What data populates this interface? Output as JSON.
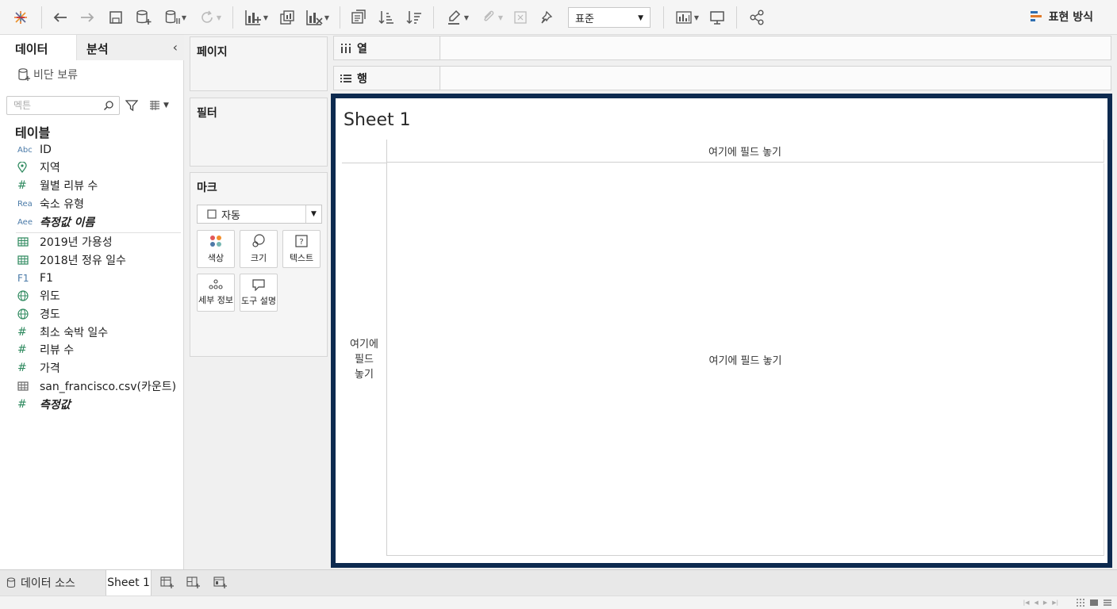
{
  "toolbar": {
    "fit_value": "표준",
    "show_me_label": "표현 방식"
  },
  "data_pane": {
    "tab_data": "데이터",
    "tab_analysis": "분석",
    "pause_updates": "비단 보류",
    "search_placeholder": "멕튼",
    "tables_title": "테이블",
    "fields": [
      {
        "type": "Abc",
        "name": "ID",
        "icon": "string-type-icon"
      },
      {
        "type": "geo",
        "name": "지역",
        "icon": "location-pin-icon"
      },
      {
        "type": "#",
        "name": "월별 리뷰 수",
        "icon": "number-type-icon"
      },
      {
        "type": "Rea",
        "name": "숙소 유형",
        "icon": "string-type-icon"
      },
      {
        "type": "Aee",
        "name": "측정값 이름",
        "icon": "string-type-icon"
      },
      {
        "type": "table",
        "name": "2019년 가용성",
        "icon": "table-icon"
      },
      {
        "type": "table",
        "name": "2018년 정유 일수",
        "icon": "table-icon"
      },
      {
        "type": "F1",
        "name": "F1",
        "icon": "f1-icon"
      },
      {
        "type": "globe",
        "name": "위도",
        "icon": "globe-icon"
      },
      {
        "type": "globe",
        "name": "경도",
        "icon": "globe-icon"
      },
      {
        "type": "#",
        "name": "최소 숙박 일수",
        "icon": "number-type-icon"
      },
      {
        "type": "#",
        "name": "리뷰 수",
        "icon": "number-type-icon"
      },
      {
        "type": "#",
        "name": "가격",
        "icon": "number-type-icon"
      },
      {
        "type": "table",
        "name": "san_francisco.csv(카운트)",
        "icon": "table-icon"
      },
      {
        "type": "#",
        "name": "측정값",
        "icon": "number-type-icon"
      }
    ]
  },
  "shelves": {
    "pages": "페이지",
    "filters": "필터",
    "marks": "마크",
    "marks_type": "자동",
    "mark_buttons": {
      "color": "색상",
      "size": "크기",
      "text": "텍스트",
      "detail": "세부 정보",
      "tooltip": "도구 설명"
    },
    "columns": "열",
    "rows": "행"
  },
  "sheet": {
    "title": "Sheet 1",
    "drop_top": "여기에 필드 놓기",
    "drop_left_1": "여기에",
    "drop_left_2": "필드",
    "drop_left_3": "놓기",
    "drop_center": "여기에 필드 놓기"
  },
  "bottom": {
    "data_source": "데이터 소스",
    "sheet_tab": "Sheet 1"
  },
  "colors": {
    "sheet_border": "#0d2a4f",
    "type_icon_blue": "#4a7aa8",
    "type_icon_green": "#2f8a5f"
  }
}
